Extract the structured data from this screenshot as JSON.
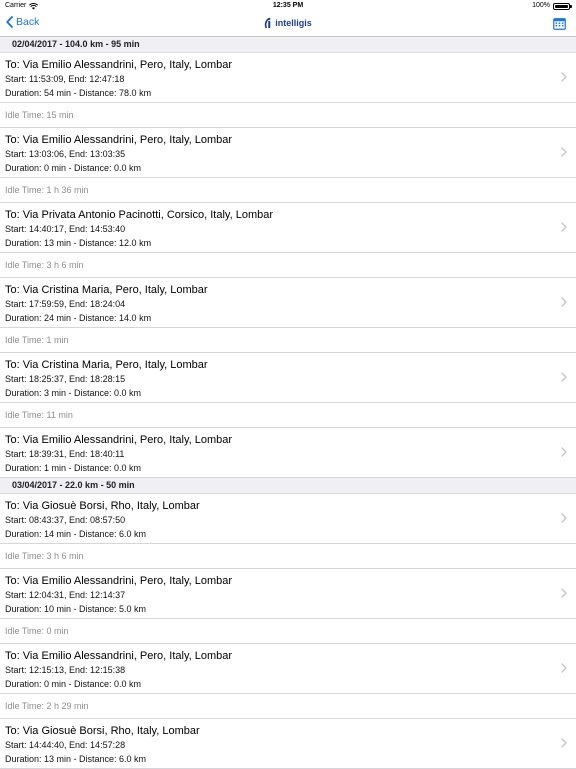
{
  "status_bar": {
    "carrier": "Carrier",
    "time": "12:35 PM",
    "battery": "100%"
  },
  "nav": {
    "back_label": "Back",
    "logo_text": "intelligis"
  },
  "days": [
    {
      "header": "02/04/2017 - 104.0 km - 95 min",
      "trips": [
        {
          "dest": "To: Via Emilio Alessandrini, Pero, Italy, Lombar",
          "times": "Start: 11:53:09, End: 12:47:18",
          "stats": "Duration: 54 min - Distance: 78.0 km",
          "idle": "Idle Time: 15 min"
        },
        {
          "dest": "To: Via Emilio Alessandrini, Pero, Italy, Lombar",
          "times": "Start: 13:03:06, End: 13:03:35",
          "stats": "Duration: 0 min - Distance: 0.0 km",
          "idle": "Idle Time: 1 h 36 min"
        },
        {
          "dest": "To: Via Privata Antonio Pacinotti, Corsico, Italy, Lombar",
          "times": "Start: 14:40:17, End: 14:53:40",
          "stats": "Duration: 13 min - Distance: 12.0 km",
          "idle": "Idle Time: 3 h 6 min"
        },
        {
          "dest": "To: Via Cristina Maria, Pero, Italy, Lombar",
          "times": "Start: 17:59:59, End: 18:24:04",
          "stats": "Duration: 24 min - Distance: 14.0 km",
          "idle": "Idle Time: 1 min"
        },
        {
          "dest": "To: Via Cristina Maria, Pero, Italy, Lombar",
          "times": "Start: 18:25:37, End: 18:28:15",
          "stats": "Duration: 3 min - Distance: 0.0 km",
          "idle": "Idle Time: 11 min"
        },
        {
          "dest": "To: Via Emilio Alessandrini, Pero, Italy, Lombar",
          "times": "Start: 18:39:31, End: 18:40:11",
          "stats": "Duration: 1 min - Distance: 0.0 km",
          "idle": ""
        }
      ]
    },
    {
      "header": "03/04/2017 - 22.0 km - 50 min",
      "trips": [
        {
          "dest": "To: Via Giosuè Borsi, Rho, Italy, Lombar",
          "times": "Start: 08:43:37, End: 08:57:50",
          "stats": "Duration: 14 min - Distance: 6.0 km",
          "idle": "Idle Time: 3 h 6 min"
        },
        {
          "dest": "To: Via Emilio Alessandrini, Pero, Italy, Lombar",
          "times": "Start: 12:04:31, End: 12:14:37",
          "stats": "Duration: 10 min - Distance: 5.0 km",
          "idle": "Idle Time: 0 min"
        },
        {
          "dest": "To: Via Emilio Alessandrini, Pero, Italy, Lombar",
          "times": "Start: 12:15:13, End: 12:15:38",
          "stats": "Duration: 0 min - Distance: 0.0 km",
          "idle": "Idle Time: 2 h 29 min"
        },
        {
          "dest": "To: Via Giosuè Borsi, Rho, Italy, Lombar",
          "times": "Start: 14:44:40, End: 14:57:28",
          "stats": "Duration: 13 min - Distance: 6.0 km",
          "idle": ""
        }
      ]
    }
  ],
  "colors": {
    "accent": "#1a73e8",
    "section_bg": "#efeff4",
    "idle_text": "#8e8e93"
  }
}
